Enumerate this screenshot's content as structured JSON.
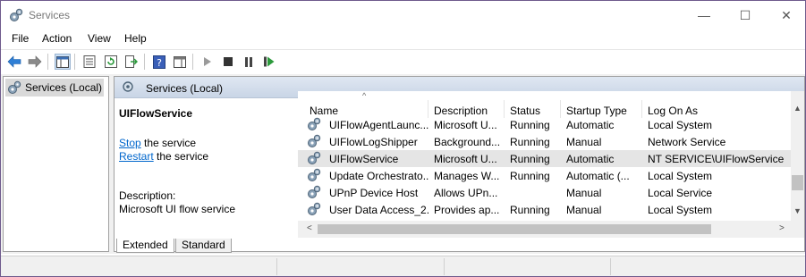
{
  "window": {
    "title": "Services",
    "min_symbol": "—",
    "max_symbol": "☐",
    "close_symbol": "✕"
  },
  "menu": [
    "File",
    "Action",
    "View",
    "Help"
  ],
  "toolbar": {
    "icons": [
      "back-arrow-icon",
      "forward-arrow-icon",
      "show-hide-console-tree-icon",
      "properties-icon",
      "refresh-icon",
      "export-list-icon",
      "help-icon",
      "show-hide-action-pane-icon",
      "start-service-icon",
      "stop-service-icon",
      "pause-service-icon",
      "restart-service-icon"
    ]
  },
  "tree": {
    "item": "Services (Local)"
  },
  "content": {
    "header": "Services (Local)",
    "selected_service": "UIFlowService",
    "stop_link": "Stop",
    "stop_suffix": " the service",
    "restart_link": "Restart",
    "restart_suffix": " the service",
    "description_label": "Description:",
    "description_text": "Microsoft UI flow service"
  },
  "list": {
    "sort_indicator": "^",
    "columns": [
      "Name",
      "Description",
      "Status",
      "Startup Type",
      "Log On As"
    ],
    "rows": [
      {
        "name": "UIFlowAgentLaunc...",
        "description": "Microsoft U...",
        "status": "Running",
        "startup": "Automatic",
        "logon": "Local System",
        "selected": false
      },
      {
        "name": "UIFlowLogShipper",
        "description": "Background...",
        "status": "Running",
        "startup": "Manual",
        "logon": "Network Service",
        "selected": false
      },
      {
        "name": "UIFlowService",
        "description": "Microsoft U...",
        "status": "Running",
        "startup": "Automatic",
        "logon": "NT SERVICE\\UIFlowService",
        "selected": true
      },
      {
        "name": "Update Orchestrato...",
        "description": "Manages W...",
        "status": "Running",
        "startup": "Automatic (...",
        "logon": "Local System",
        "selected": false
      },
      {
        "name": "UPnP Device Host",
        "description": "Allows UPn...",
        "status": "",
        "startup": "Manual",
        "logon": "Local Service",
        "selected": false
      },
      {
        "name": "User Data Access_2...",
        "description": "Provides ap...",
        "status": "Running",
        "startup": "Manual",
        "logon": "Local System",
        "selected": false
      }
    ]
  },
  "tabs": [
    "Extended",
    "Standard"
  ],
  "active_tab": "Extended",
  "scroll": {
    "up": "▲",
    "down": "▼",
    "left": "<",
    "right": ">"
  }
}
